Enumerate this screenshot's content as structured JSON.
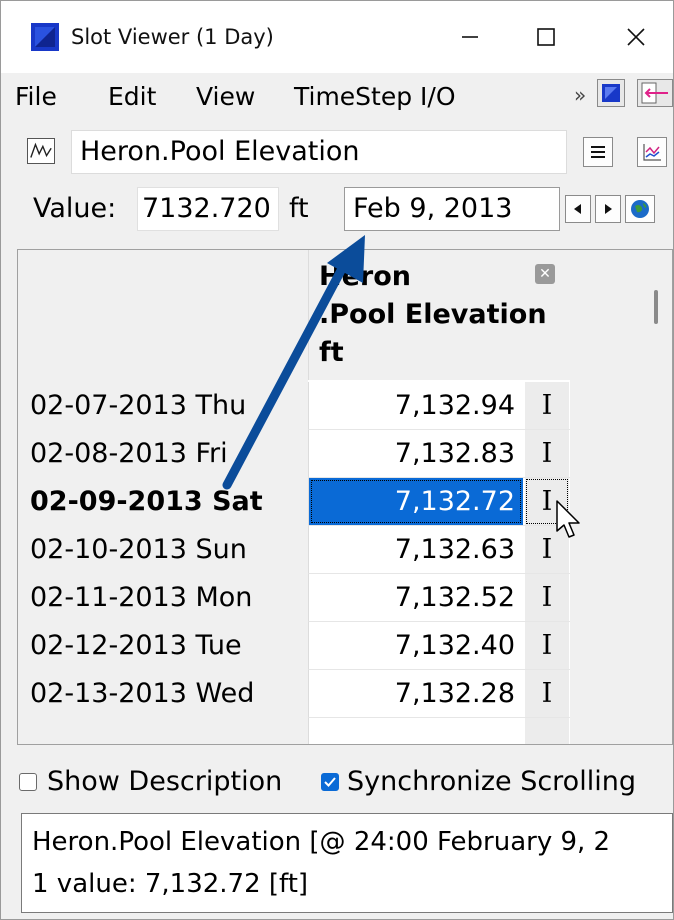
{
  "window": {
    "title": "Slot Viewer (1 Day)",
    "min_glyph": "—",
    "max_glyph": "☐",
    "close_glyph": "✕"
  },
  "menu": {
    "items": [
      "File",
      "Edit",
      "View",
      "TimeStep I/O"
    ],
    "overflow": "»"
  },
  "slot": {
    "name": "Heron.Pool Elevation"
  },
  "value_row": {
    "label": "Value:",
    "value": "7132.720",
    "unit": "ft",
    "date": "Feb 9, 2013"
  },
  "table": {
    "column_header": [
      "Heron",
      ".Pool Elevation",
      "ft"
    ],
    "close_glyph": "✕",
    "rows": [
      {
        "date": "02-07-2013 Thu",
        "value": "7,132.94",
        "flag": "I",
        "selected": false
      },
      {
        "date": "02-08-2013 Fri",
        "value": "7,132.83",
        "flag": "I",
        "selected": false
      },
      {
        "date": "02-09-2013 Sat",
        "value": "7,132.72",
        "flag": "I",
        "selected": true
      },
      {
        "date": "02-10-2013 Sun",
        "value": "7,132.63",
        "flag": "I",
        "selected": false
      },
      {
        "date": "02-11-2013 Mon",
        "value": "7,132.52",
        "flag": "I",
        "selected": false
      },
      {
        "date": "02-12-2013 Tue",
        "value": "7,132.40",
        "flag": "I",
        "selected": false
      },
      {
        "date": "02-13-2013 Wed",
        "value": "7,132.28",
        "flag": "I",
        "selected": false
      }
    ]
  },
  "options": {
    "show_description": {
      "label": "Show Description",
      "checked": false
    },
    "sync_scrolling": {
      "label": "Synchronize Scrolling",
      "checked": true
    }
  },
  "info": {
    "line1": "Heron.Pool Elevation [@ 24:00 February 9, 2",
    "line2": "1 value:  7,132.72 [ft]"
  },
  "colors": {
    "selection": "#0a6ad6",
    "annotation_arrow": "#0b4c9a"
  }
}
